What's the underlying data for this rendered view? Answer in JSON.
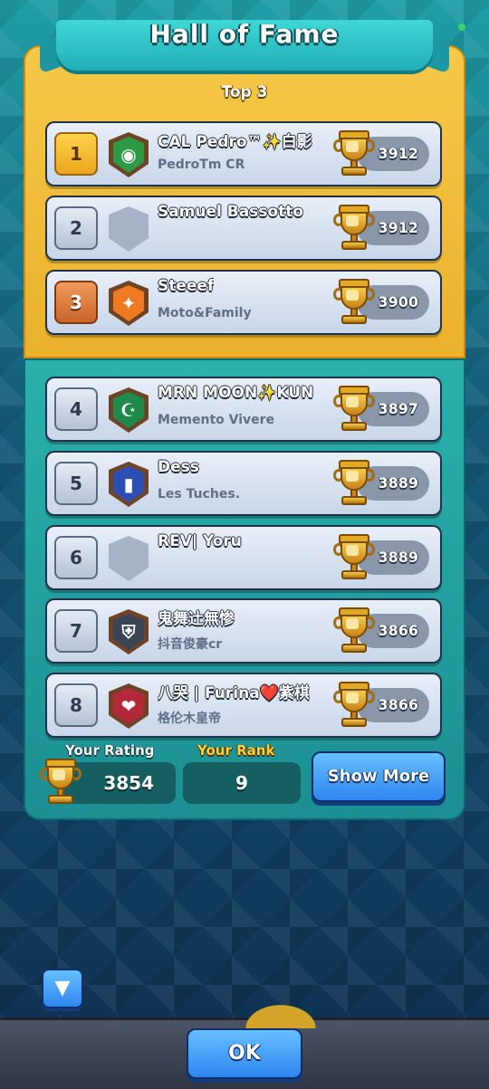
{
  "title": "Hall of Fame",
  "section_label": "Top 3",
  "players": [
    {
      "rank": "1",
      "name": "CAL Pedro™✨白影",
      "clan": "PedroTm CR",
      "trophies": "3912",
      "rank_style": "gold",
      "badge": {
        "icon": "brazil-flag-icon",
        "color": "#2e9a45",
        "symbol": "◉"
      }
    },
    {
      "rank": "2",
      "name": "Samuel Bassotto",
      "clan": "",
      "trophies": "3912",
      "rank_style": "silver",
      "badge": {
        "icon": "empty-clan-badge-icon",
        "color": "#a5b3c7",
        "symbol": ""
      }
    },
    {
      "rank": "3",
      "name": "Steeef",
      "clan": "Moto&Family",
      "trophies": "3900",
      "rank_style": "bronze",
      "badge": {
        "icon": "star-clan-badge-icon",
        "color": "#f07a22",
        "symbol": "✦"
      }
    },
    {
      "rank": "4",
      "name": "MRN MOON✨KUN",
      "clan": "Memento Vivere",
      "trophies": "3897",
      "rank_style": "silver",
      "badge": {
        "icon": "crescent-flag-icon",
        "color": "#1f8a4c",
        "symbol": "☪"
      }
    },
    {
      "rank": "5",
      "name": "Dess",
      "clan": "Les Tuches.",
      "trophies": "3889",
      "rank_style": "silver",
      "badge": {
        "icon": "france-flag-icon",
        "color": "#2b4fb6",
        "symbol": "▮"
      }
    },
    {
      "rank": "6",
      "name": "REV| Yoru",
      "clan": "",
      "trophies": "3889",
      "rank_style": "silver",
      "badge": {
        "icon": "empty-clan-badge-icon",
        "color": "#a5b3c7",
        "symbol": ""
      }
    },
    {
      "rank": "7",
      "name": "鬼舞辻無惨",
      "clan": "抖音俊豪cr",
      "trophies": "3866",
      "rank_style": "silver",
      "badge": {
        "icon": "helmet-clan-badge-icon",
        "color": "#3a4656",
        "symbol": "⛨"
      }
    },
    {
      "rank": "8",
      "name": "八哭 | Furina❤️紫棋",
      "clan": "格伦木皇帝",
      "trophies": "3866",
      "rank_style": "silver",
      "badge": {
        "icon": "heart-clan-badge-icon",
        "color": "#b4283a",
        "symbol": "❤"
      }
    }
  ],
  "footer": {
    "your_rating_label": "Your Rating",
    "your_rating_value": "3854",
    "your_rank_label": "Your Rank",
    "your_rank_value": "9",
    "show_more_label": "Show More"
  },
  "ok_label": "OK",
  "colors": {
    "gold_panel": "#f2bf3e",
    "teal_panel": "#23a3a3",
    "button_blue": "#3b91f2"
  }
}
